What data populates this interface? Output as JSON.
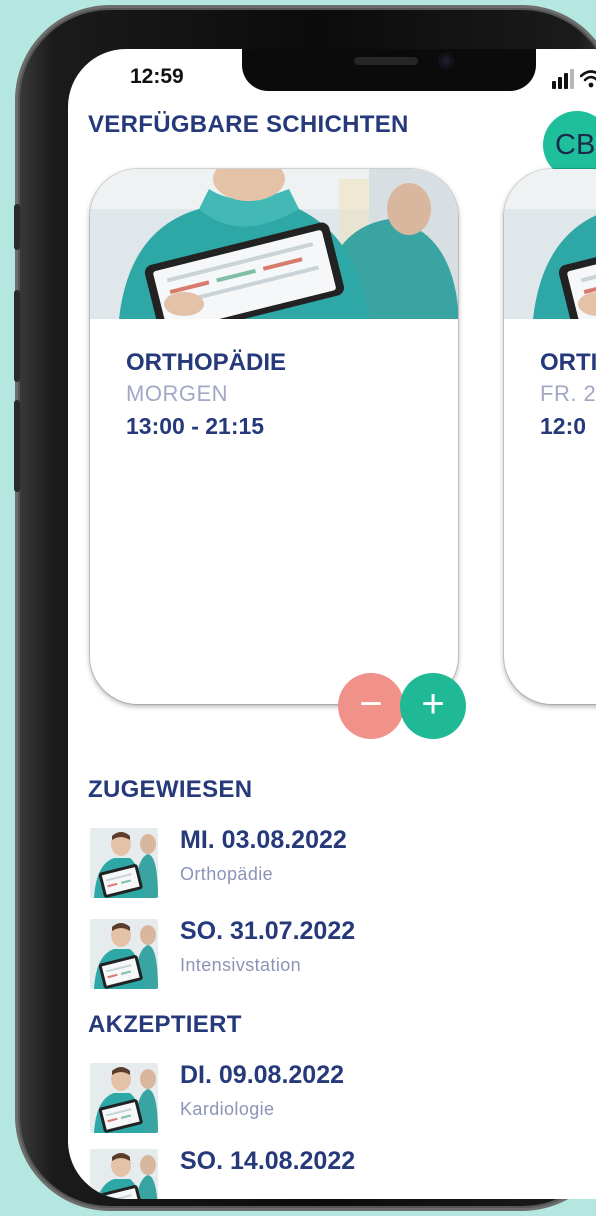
{
  "status_bar": {
    "time": "12:59"
  },
  "header": {
    "title": "VERFÜGBARE SCHICHTEN",
    "avatar_initials": "CB"
  },
  "shift_cards": [
    {
      "title": "ORTHOPÄDIE",
      "subtitle": "MORGEN",
      "time": "13:00 - 21:15"
    },
    {
      "title": "ORTI",
      "subtitle": "FR. 2",
      "time": "12:0"
    }
  ],
  "actions": {
    "decline_symbol": "−",
    "accept_symbol": "+"
  },
  "assigned": {
    "title": "ZUGEWIESEN",
    "items": [
      {
        "date": "MI. 03.08.2022",
        "department": "Orthopädie"
      },
      {
        "date": "SO. 31.07.2022",
        "department": "Intensivstation"
      }
    ]
  },
  "accepted": {
    "title": "AKZEPTIERT",
    "items": [
      {
        "date": "DI. 09.08.2022",
        "department": "Kardiologie"
      },
      {
        "date": "SO. 14.08.2022",
        "department": ""
      }
    ]
  },
  "colors": {
    "background": "#b5e7e1",
    "primary_text": "#26397a",
    "secondary_text": "#a2a7c6",
    "accent_green": "#1fb996",
    "accent_red": "#f0918a"
  },
  "icons": [
    "signal-icon",
    "wifi-icon",
    "battery-icon",
    "minus-icon",
    "plus-icon"
  ]
}
